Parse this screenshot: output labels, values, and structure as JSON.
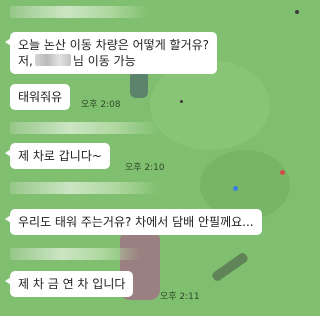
{
  "chat": {
    "messages": [
      {
        "lines": [
          "오늘 논산 이동 차량은 어떻게 할거유?",
          "저,",
          "님 이동 가능"
        ],
        "time": ""
      },
      {
        "text": "태워줘유",
        "time": "오후 2:08"
      },
      {
        "text": "제 차로 갑니다~",
        "time": "오후 2:10"
      },
      {
        "text": "우리도 태워 주는거유? 차에서 담배 안필께요...",
        "time": ""
      },
      {
        "text": "제 차 금 연 차 입니다",
        "time": "오후 2:11"
      }
    ]
  },
  "colors": {
    "background": "#7fbf6f",
    "bubble": "#ffffff",
    "time_text": "#2f4a28"
  }
}
